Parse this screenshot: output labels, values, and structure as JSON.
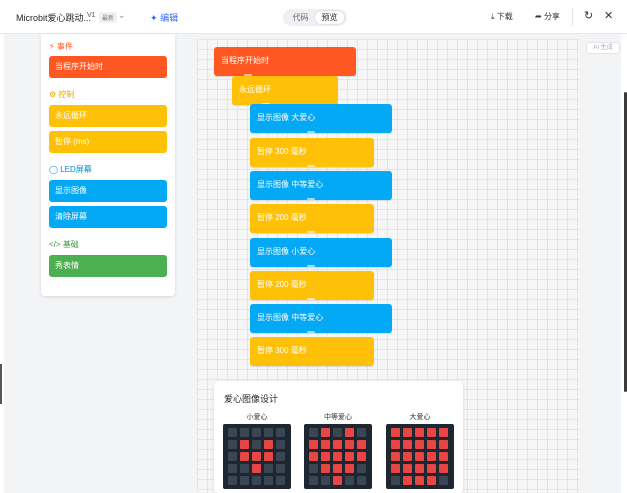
{
  "topbar": {
    "title": "Microbit爱心跳动...",
    "version": "V1",
    "tag": "最新",
    "edit_label": "编辑",
    "tabs": [
      "代码",
      "预览"
    ],
    "download_label": "下载",
    "share_label": "分享"
  },
  "ai_label": "AI 生成",
  "toolbox": {
    "categories": [
      {
        "label": "事件",
        "color": "#ff5722",
        "icon": "lightning-icon",
        "blocks": [
          "当程序开始时"
        ]
      },
      {
        "label": "控制",
        "color": "#ffc107",
        "icon": "gears-icon",
        "blocks": [
          "永远循环",
          "暂停 (ms)"
        ]
      },
      {
        "label": "LED屏幕",
        "color": "#03a9f4",
        "icon": "bulb-icon",
        "blocks": [
          "显示图像",
          "清除屏幕"
        ]
      },
      {
        "label": "基础",
        "color": "#4caf50",
        "icon": "code-icon",
        "blocks": [
          "秀表情"
        ]
      }
    ]
  },
  "program": {
    "start": "当程序开始时",
    "loop": "永远循环",
    "statements": [
      "显示图像 大爱心",
      "暂停 300 毫秒",
      "显示图像 中等爱心",
      "暂停 200 毫秒",
      "显示图像 小爱心",
      "暂停 200 毫秒",
      "显示图像 中等爱心",
      "暂停 300 毫秒"
    ]
  },
  "heart_design": {
    "title": "爱心图像设计",
    "grids": [
      {
        "label": "小爱心",
        "pixels": [
          [
            0,
            0,
            0,
            0,
            0
          ],
          [
            0,
            1,
            0,
            1,
            0
          ],
          [
            0,
            1,
            1,
            1,
            0
          ],
          [
            0,
            0,
            1,
            0,
            0
          ],
          [
            0,
            0,
            0,
            0,
            0
          ]
        ]
      },
      {
        "label": "中等爱心",
        "pixels": [
          [
            0,
            1,
            0,
            1,
            0
          ],
          [
            1,
            1,
            1,
            1,
            1
          ],
          [
            1,
            1,
            1,
            1,
            1
          ],
          [
            0,
            1,
            1,
            1,
            0
          ],
          [
            0,
            0,
            1,
            0,
            0
          ]
        ]
      },
      {
        "label": "大爱心",
        "pixels": [
          [
            1,
            1,
            1,
            1,
            1
          ],
          [
            1,
            1,
            1,
            1,
            1
          ],
          [
            1,
            1,
            1,
            1,
            1
          ],
          [
            1,
            1,
            1,
            1,
            1
          ],
          [
            0,
            1,
            1,
            1,
            0
          ]
        ]
      }
    ]
  }
}
